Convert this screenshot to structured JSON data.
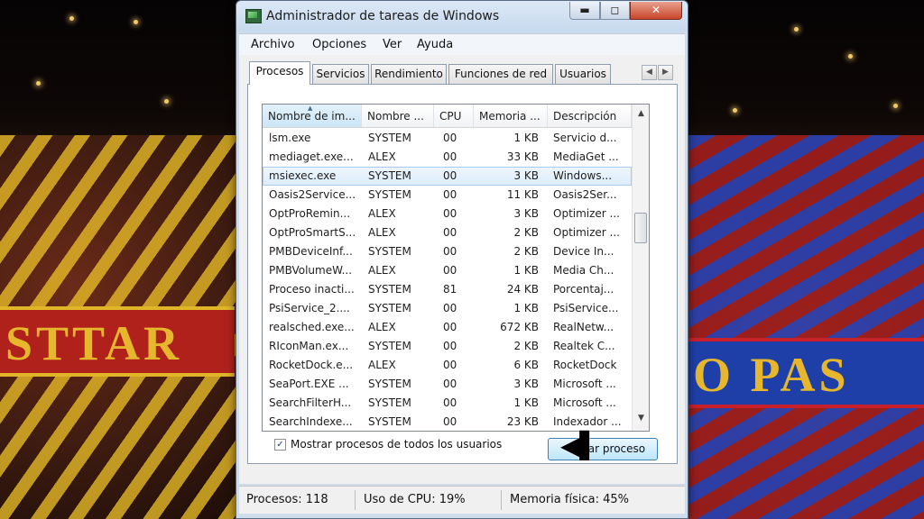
{
  "window": {
    "title": "Administrador de tareas de Windows",
    "controls": {
      "minimize": "▬",
      "maximize": "◻",
      "close": "✕"
    }
  },
  "menu": [
    "Archivo",
    "Opciones",
    "Ver",
    "Ayuda"
  ],
  "tabs": {
    "items": [
      "Procesos",
      "Servicios",
      "Rendimiento",
      "Funciones de red",
      "Usuarios"
    ],
    "active": "Procesos",
    "scroll_left": "◀",
    "scroll_right": "▶"
  },
  "table": {
    "columns": [
      "Nombre de im...",
      "Nombre ...",
      "CPU",
      "Memoria ...",
      "Descripción"
    ],
    "sort_indicator": "▲",
    "selected_row": 2,
    "rows": [
      [
        "lsm.exe",
        "SYSTEM",
        "00",
        "1 KB",
        "Servicio d..."
      ],
      [
        "mediaget.exe...",
        "ALEX",
        "00",
        "33 KB",
        "MediaGet ..."
      ],
      [
        "msiexec.exe",
        "SYSTEM",
        "00",
        "3 KB",
        "Windows..."
      ],
      [
        "Oasis2Service...",
        "SYSTEM",
        "00",
        "11 KB",
        "Oasis2Ser..."
      ],
      [
        "OptProRemin...",
        "ALEX",
        "00",
        "3 KB",
        "Optimizer ..."
      ],
      [
        "OptProSmartS...",
        "ALEX",
        "00",
        "2 KB",
        "Optimizer ..."
      ],
      [
        "PMBDeviceInf...",
        "SYSTEM",
        "00",
        "2 KB",
        "Device In..."
      ],
      [
        "PMBVolumeW...",
        "ALEX",
        "00",
        "1 KB",
        "Media Ch..."
      ],
      [
        "Proceso inacti...",
        "SYSTEM",
        "81",
        "24 KB",
        "Porcentaj..."
      ],
      [
        "PsiService_2....",
        "SYSTEM",
        "00",
        "1 KB",
        "PsiService..."
      ],
      [
        "realsched.exe...",
        "ALEX",
        "00",
        "672 KB",
        "RealNetw..."
      ],
      [
        "RIconMan.ex...",
        "SYSTEM",
        "00",
        "2 KB",
        "Realtek C..."
      ],
      [
        "RocketDock.e...",
        "ALEX",
        "00",
        "6 KB",
        "RocketDock"
      ],
      [
        "SeaPort.EXE ...",
        "SYSTEM",
        "00",
        "3 KB",
        "Microsoft ..."
      ],
      [
        "SearchFilterH...",
        "SYSTEM",
        "00",
        "1 KB",
        "Microsoft ..."
      ],
      [
        "SearchIndexe...",
        "SYSTEM",
        "00",
        "23 KB",
        "Indexador ..."
      ]
    ],
    "scroll_up": "▲",
    "scroll_down": "▼"
  },
  "show_all_users": {
    "label": "Mostrar procesos de todos los usuarios",
    "checked": true,
    "mark": "✓"
  },
  "end_process_button": "rar proceso",
  "status": {
    "processes": "Procesos: 118",
    "cpu": "Uso de CPU: 19%",
    "memory": "Memoria física: 45%"
  },
  "background": {
    "banner_left": "STTAR",
    "banner_right": "O PAS"
  }
}
